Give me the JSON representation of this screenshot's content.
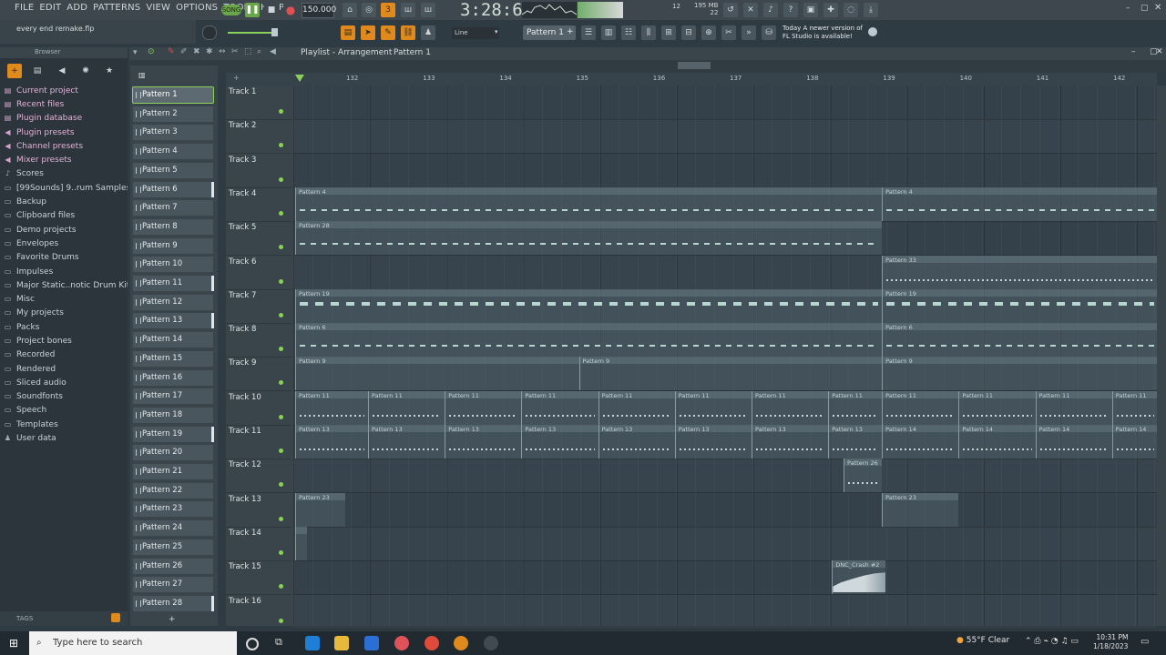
{
  "menu": [
    "FILE",
    "EDIT",
    "ADD",
    "PATTERNS",
    "VIEW",
    "OPTIONS",
    "TOOLS",
    "HELP"
  ],
  "transport": {
    "song_label": "SONG",
    "tempo": "150.000",
    "time": "3:28:62",
    "mem": "195 MB",
    "cpu": "12",
    "poly": "22"
  },
  "hint": "every end remake.flp",
  "pattern_selector": "Pattern 1",
  "snap_selector": "Line",
  "news": {
    "line1": "Today  A newer version of",
    "line2": "FL Studio is available!"
  },
  "browser": {
    "title": "Browser",
    "items": [
      {
        "label": "Current project",
        "icon": "project-icon",
        "hl": true
      },
      {
        "label": "Recent files",
        "icon": "recent-icon",
        "hl": true
      },
      {
        "label": "Plugin database",
        "icon": "plugin-db-icon",
        "hl": true
      },
      {
        "label": "Plugin presets",
        "icon": "plugin-presets-icon",
        "hl": true
      },
      {
        "label": "Channel presets",
        "icon": "channel-presets-icon",
        "hl": true
      },
      {
        "label": "Mixer presets",
        "icon": "mixer-presets-icon",
        "hl": true
      },
      {
        "label": "Scores",
        "icon": "scores-icon",
        "hl": false
      },
      {
        "label": "[99Sounds] 9..rum Samples",
        "icon": "folder-icon",
        "hl": false
      },
      {
        "label": "Backup",
        "icon": "folder-icon",
        "hl": false
      },
      {
        "label": "Clipboard files",
        "icon": "folder-icon",
        "hl": false
      },
      {
        "label": "Demo projects",
        "icon": "folder-icon",
        "hl": false
      },
      {
        "label": "Envelopes",
        "icon": "folder-icon",
        "hl": false
      },
      {
        "label": "Favorite Drums",
        "icon": "folder-icon",
        "hl": false
      },
      {
        "label": "Impulses",
        "icon": "folder-icon",
        "hl": false
      },
      {
        "label": "Major Static..notic Drum Kit",
        "icon": "folder-icon",
        "hl": false
      },
      {
        "label": "Misc",
        "icon": "folder-icon",
        "hl": false
      },
      {
        "label": "My projects",
        "icon": "folder-icon",
        "hl": false
      },
      {
        "label": "Packs",
        "icon": "folder-icon",
        "hl": false
      },
      {
        "label": "Project bones",
        "icon": "folder-icon",
        "hl": false
      },
      {
        "label": "Recorded",
        "icon": "folder-icon",
        "hl": false
      },
      {
        "label": "Rendered",
        "icon": "folder-icon",
        "hl": false
      },
      {
        "label": "Sliced audio",
        "icon": "folder-icon",
        "hl": false
      },
      {
        "label": "Soundfonts",
        "icon": "folder-icon",
        "hl": false
      },
      {
        "label": "Speech",
        "icon": "folder-icon",
        "hl": false
      },
      {
        "label": "Templates",
        "icon": "folder-icon",
        "hl": false
      },
      {
        "label": "User data",
        "icon": "user-icon",
        "hl": false
      }
    ],
    "tags_label": "TAGS"
  },
  "patterns": [
    "Pattern 1",
    "Pattern 2",
    "Pattern 3",
    "Pattern 4",
    "Pattern 5",
    "Pattern 6",
    "Pattern 7",
    "Pattern 8",
    "Pattern 9",
    "Pattern 10",
    "Pattern 11",
    "Pattern 12",
    "Pattern 13",
    "Pattern 14",
    "Pattern 15",
    "Pattern 16",
    "Pattern 17",
    "Pattern 18",
    "Pattern 19",
    "Pattern 20",
    "Pattern 21",
    "Pattern 22",
    "Pattern 23",
    "Pattern 24",
    "Pattern 25",
    "Pattern 26",
    "Pattern 27",
    "Pattern 28"
  ],
  "playlist": {
    "title": "Playlist - Arrangement",
    "current_pattern": "Pattern 1",
    "ruler": [
      "132",
      "133",
      "134",
      "135",
      "136",
      "137",
      "138",
      "139",
      "140",
      "141",
      "142"
    ],
    "tracks": [
      "Track 1",
      "Track 2",
      "Track 3",
      "Track 4",
      "Track 5",
      "Track 6",
      "Track 7",
      "Track 8",
      "Track 9",
      "Track 10",
      "Track 11",
      "Track 12",
      "Track 13",
      "Track 14",
      "Track 15",
      "Track 16"
    ],
    "clips": [
      {
        "track": 3,
        "start": 0,
        "len": 7.65,
        "label": "Pattern 4",
        "notes": "dash"
      },
      {
        "track": 3,
        "start": 7.65,
        "len": 3.6,
        "label": "Pattern 4",
        "notes": "dash"
      },
      {
        "track": 4,
        "start": 0,
        "len": 7.65,
        "label": "Pattern 28",
        "notes": "dash"
      },
      {
        "track": 5,
        "start": 7.65,
        "len": 3.6,
        "label": "Pattern 33",
        "notes": "dot"
      },
      {
        "track": 6,
        "start": 0,
        "len": 7.65,
        "label": "Pattern 19",
        "notes": "block"
      },
      {
        "track": 6,
        "start": 7.65,
        "len": 3.6,
        "label": "Pattern 19",
        "notes": "block"
      },
      {
        "track": 7,
        "start": 0,
        "len": 7.65,
        "label": "Pattern 6",
        "notes": "dash"
      },
      {
        "track": 7,
        "start": 7.65,
        "len": 3.6,
        "label": "Pattern 6",
        "notes": "dash"
      },
      {
        "track": 8,
        "start": 0,
        "len": 3.7,
        "label": "Pattern 9",
        "notes": "none"
      },
      {
        "track": 8,
        "start": 3.7,
        "len": 3.95,
        "label": "Pattern 9",
        "notes": "none"
      },
      {
        "track": 8,
        "start": 7.65,
        "len": 3.6,
        "label": "Pattern 9",
        "notes": "none"
      },
      {
        "track": 9,
        "start": 0,
        "len": 0.95,
        "label": "Pattern 11",
        "notes": "dot"
      },
      {
        "track": 9,
        "start": 0.95,
        "len": 1.0,
        "label": "Pattern 11",
        "notes": "dot"
      },
      {
        "track": 9,
        "start": 1.95,
        "len": 1.0,
        "label": "Pattern 11",
        "notes": "dot"
      },
      {
        "track": 9,
        "start": 2.95,
        "len": 1.0,
        "label": "Pattern 11",
        "notes": "dot"
      },
      {
        "track": 9,
        "start": 3.95,
        "len": 1.0,
        "label": "Pattern 11",
        "notes": "dot"
      },
      {
        "track": 9,
        "start": 4.95,
        "len": 1.0,
        "label": "Pattern 11",
        "notes": "dot"
      },
      {
        "track": 9,
        "start": 5.95,
        "len": 1.0,
        "label": "Pattern 11",
        "notes": "dot"
      },
      {
        "track": 9,
        "start": 6.95,
        "len": 0.7,
        "label": "Pattern 11",
        "notes": "dot"
      },
      {
        "track": 9,
        "start": 7.65,
        "len": 1.0,
        "label": "Pattern 11",
        "notes": "dot"
      },
      {
        "track": 9,
        "start": 8.65,
        "len": 1.0,
        "label": "Pattern 11",
        "notes": "dot"
      },
      {
        "track": 9,
        "start": 9.65,
        "len": 1.0,
        "label": "Pattern 11",
        "notes": "dot"
      },
      {
        "track": 9,
        "start": 10.65,
        "len": 0.6,
        "label": "Pattern 11",
        "notes": "dot"
      },
      {
        "track": 10,
        "start": 0,
        "len": 0.95,
        "label": "Pattern 13",
        "notes": "dot"
      },
      {
        "track": 10,
        "start": 0.95,
        "len": 1.0,
        "label": "Pattern 13",
        "notes": "dot"
      },
      {
        "track": 10,
        "start": 1.95,
        "len": 1.0,
        "label": "Pattern 13",
        "notes": "dot"
      },
      {
        "track": 10,
        "start": 2.95,
        "len": 1.0,
        "label": "Pattern 13",
        "notes": "dot"
      },
      {
        "track": 10,
        "start": 3.95,
        "len": 1.0,
        "label": "Pattern 13",
        "notes": "dot"
      },
      {
        "track": 10,
        "start": 4.95,
        "len": 1.0,
        "label": "Pattern 13",
        "notes": "dot"
      },
      {
        "track": 10,
        "start": 5.95,
        "len": 1.0,
        "label": "Pattern 13",
        "notes": "dot"
      },
      {
        "track": 10,
        "start": 6.95,
        "len": 0.7,
        "label": "Pattern 13",
        "notes": "dot"
      },
      {
        "track": 10,
        "start": 7.65,
        "len": 1.0,
        "label": "Pattern 14",
        "notes": "dot"
      },
      {
        "track": 10,
        "start": 8.65,
        "len": 1.0,
        "label": "Pattern 14",
        "notes": "dot"
      },
      {
        "track": 10,
        "start": 9.65,
        "len": 1.0,
        "label": "Pattern 14",
        "notes": "dot"
      },
      {
        "track": 10,
        "start": 10.65,
        "len": 0.6,
        "label": "Pattern 14",
        "notes": "dot"
      },
      {
        "track": 11,
        "start": 7.15,
        "len": 0.5,
        "label": "Pattern 26",
        "notes": "dot"
      },
      {
        "track": 12,
        "start": 0,
        "len": 0.65,
        "label": "Pattern 23",
        "notes": "none"
      },
      {
        "track": 12,
        "start": 7.65,
        "len": 1.0,
        "label": "Pattern 23",
        "notes": "none"
      },
      {
        "track": 13,
        "start": 0,
        "len": 0.15,
        "label": "",
        "notes": "none"
      },
      {
        "track": 14,
        "start": 7.0,
        "len": 0.7,
        "label": "DNC_Crash #2",
        "notes": "wave"
      }
    ]
  },
  "taskbar": {
    "search_placeholder": "Type here to search",
    "weather": "55°F  Clear",
    "time": "10:31 PM",
    "date": "1/18/2023"
  },
  "colors": {
    "accent_green": "#8ad05a",
    "accent_orange": "#e08a1e",
    "bg": "#34414a"
  }
}
